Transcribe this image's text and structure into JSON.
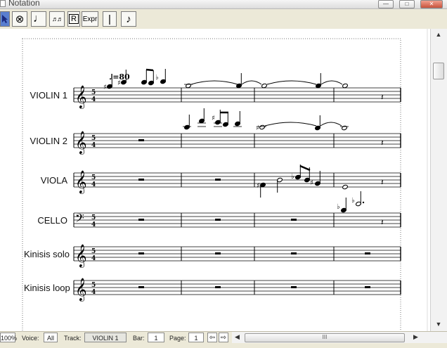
{
  "window": {
    "title": "Notation",
    "controls": {
      "minimize": "—",
      "maximize": "□",
      "close": "✕"
    }
  },
  "toolbar": {
    "tools": [
      {
        "id": "select",
        "icon": "arrow-pointer-icon",
        "glyph": ""
      },
      {
        "id": "erase",
        "icon": "circle-x-icon",
        "glyph": "⊗"
      },
      {
        "id": "note",
        "icon": "quarter-note-icon",
        "glyph": "♩"
      },
      {
        "id": "beam",
        "icon": "beam-notes-icon",
        "glyph": "♬♬"
      },
      {
        "id": "rest",
        "icon": "rest-r-icon",
        "glyph": "R"
      },
      {
        "id": "expr",
        "icon": "expression-icon",
        "glyph": "Expr"
      },
      {
        "id": "barline",
        "icon": "barline-icon",
        "glyph": "|"
      },
      {
        "id": "play",
        "icon": "play-note-icon",
        "glyph": "♪"
      }
    ]
  },
  "score": {
    "tempo": "♩=80",
    "time_signature": {
      "top": "5",
      "bottom": "4"
    },
    "rest_glyph": "𝄽",
    "instruments": [
      {
        "name": "VIOLIN 1",
        "clef": "treble"
      },
      {
        "name": "VIOLIN 2",
        "clef": "treble"
      },
      {
        "name": "VIOLA",
        "clef": "treble"
      },
      {
        "name": "CELLO",
        "clef": "bass"
      },
      {
        "name": "Kinisis solo",
        "clef": "treble"
      },
      {
        "name": "Kinisis loop",
        "clef": "treble"
      }
    ]
  },
  "statusbar": {
    "zoom": "100%",
    "voice_label": "Voice:",
    "voice_value": "All",
    "track_label": "Track:",
    "track_value": "VIOLIN 1",
    "bar_label": "Bar:",
    "bar_value": "1",
    "page_label": "Page:",
    "page_value": "1",
    "grip": "III"
  }
}
